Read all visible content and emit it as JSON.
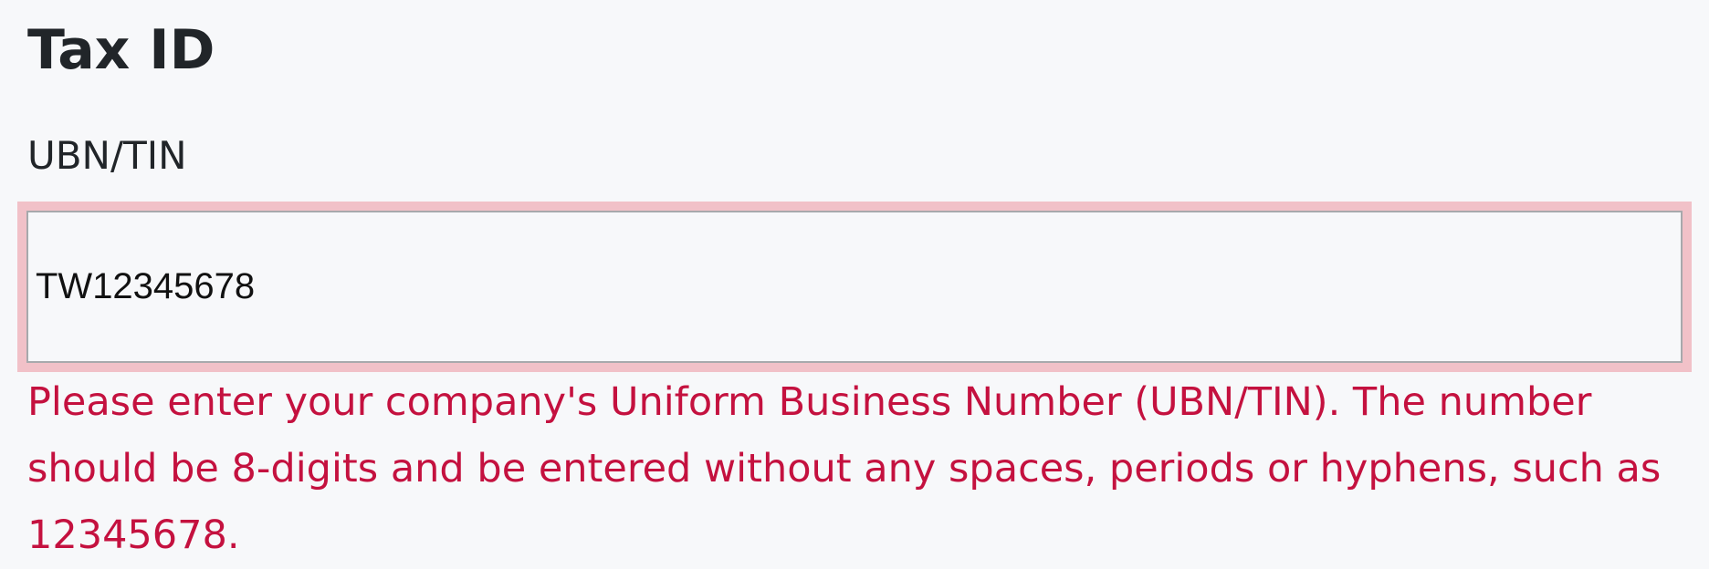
{
  "form": {
    "title": "Tax ID",
    "label": "UBN/TIN",
    "input_value": "TW12345678",
    "error_message": "Please enter your company's Uniform Business Number (UBN/TIN). The number should be 8-digits and be entered without any spaces, periods or hyphens, such as 12345678."
  },
  "colors": {
    "background": "#f7f8fa",
    "text": "#212529",
    "error": "#c4113f",
    "error_focus_ring": "#f1c1c8",
    "input_border": "#a7a9ac"
  }
}
